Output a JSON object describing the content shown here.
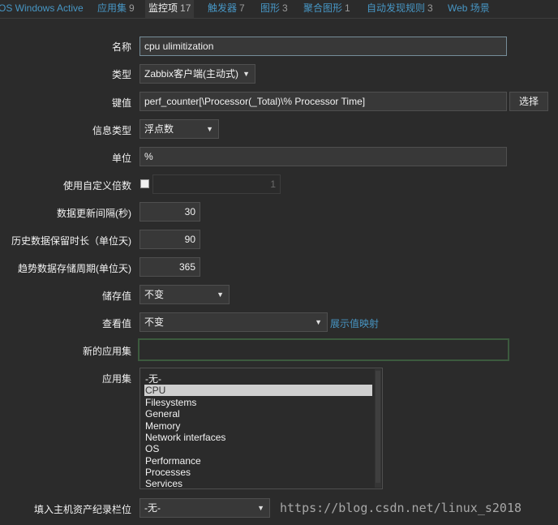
{
  "tabs": [
    {
      "label": "OS Windows Active",
      "count": ""
    },
    {
      "label": "应用集",
      "count": "9"
    },
    {
      "label": "监控项",
      "count": "17"
    },
    {
      "label": "触发器",
      "count": "7"
    },
    {
      "label": "图形",
      "count": "3"
    },
    {
      "label": "聚合图形",
      "count": "1"
    },
    {
      "label": "自动发现规则",
      "count": "3"
    },
    {
      "label": "Web 场景",
      "count": ""
    }
  ],
  "form": {
    "name": {
      "label": "名称",
      "value": "cpu ulimitization"
    },
    "type": {
      "label": "类型",
      "value": "Zabbix客户端(主动式)"
    },
    "key": {
      "label": "键值",
      "value": "perf_counter[\\Processor(_Total)\\% Processor Time]",
      "button": "选择"
    },
    "info_type": {
      "label": "信息类型",
      "value": "浮点数"
    },
    "units": {
      "label": "单位",
      "value": "%"
    },
    "multiplier": {
      "label": "使用自定义倍数",
      "value": "1"
    },
    "interval": {
      "label": "数据更新间隔(秒)",
      "value": "30"
    },
    "history": {
      "label": "历史数据保留时长（单位天)",
      "value": "90"
    },
    "trends": {
      "label": "趋势数据存储周期(单位天)",
      "value": "365"
    },
    "store_value": {
      "label": "储存值",
      "value": "不变"
    },
    "show_value": {
      "label": "查看值",
      "value": "不变",
      "link": "展示值映射"
    },
    "new_application": {
      "label": "新的应用集",
      "value": ""
    },
    "applications": {
      "label": "应用集",
      "items": [
        "-无-",
        "CPU",
        "Filesystems",
        "General",
        "Memory",
        "Network interfaces",
        "OS",
        "Performance",
        "Processes",
        "Services"
      ],
      "selected": "CPU"
    },
    "inventory": {
      "label": "填入主机资产纪录栏位",
      "value": "-无-"
    }
  },
  "watermark": "https://blog.csdn.net/linux_s2018"
}
